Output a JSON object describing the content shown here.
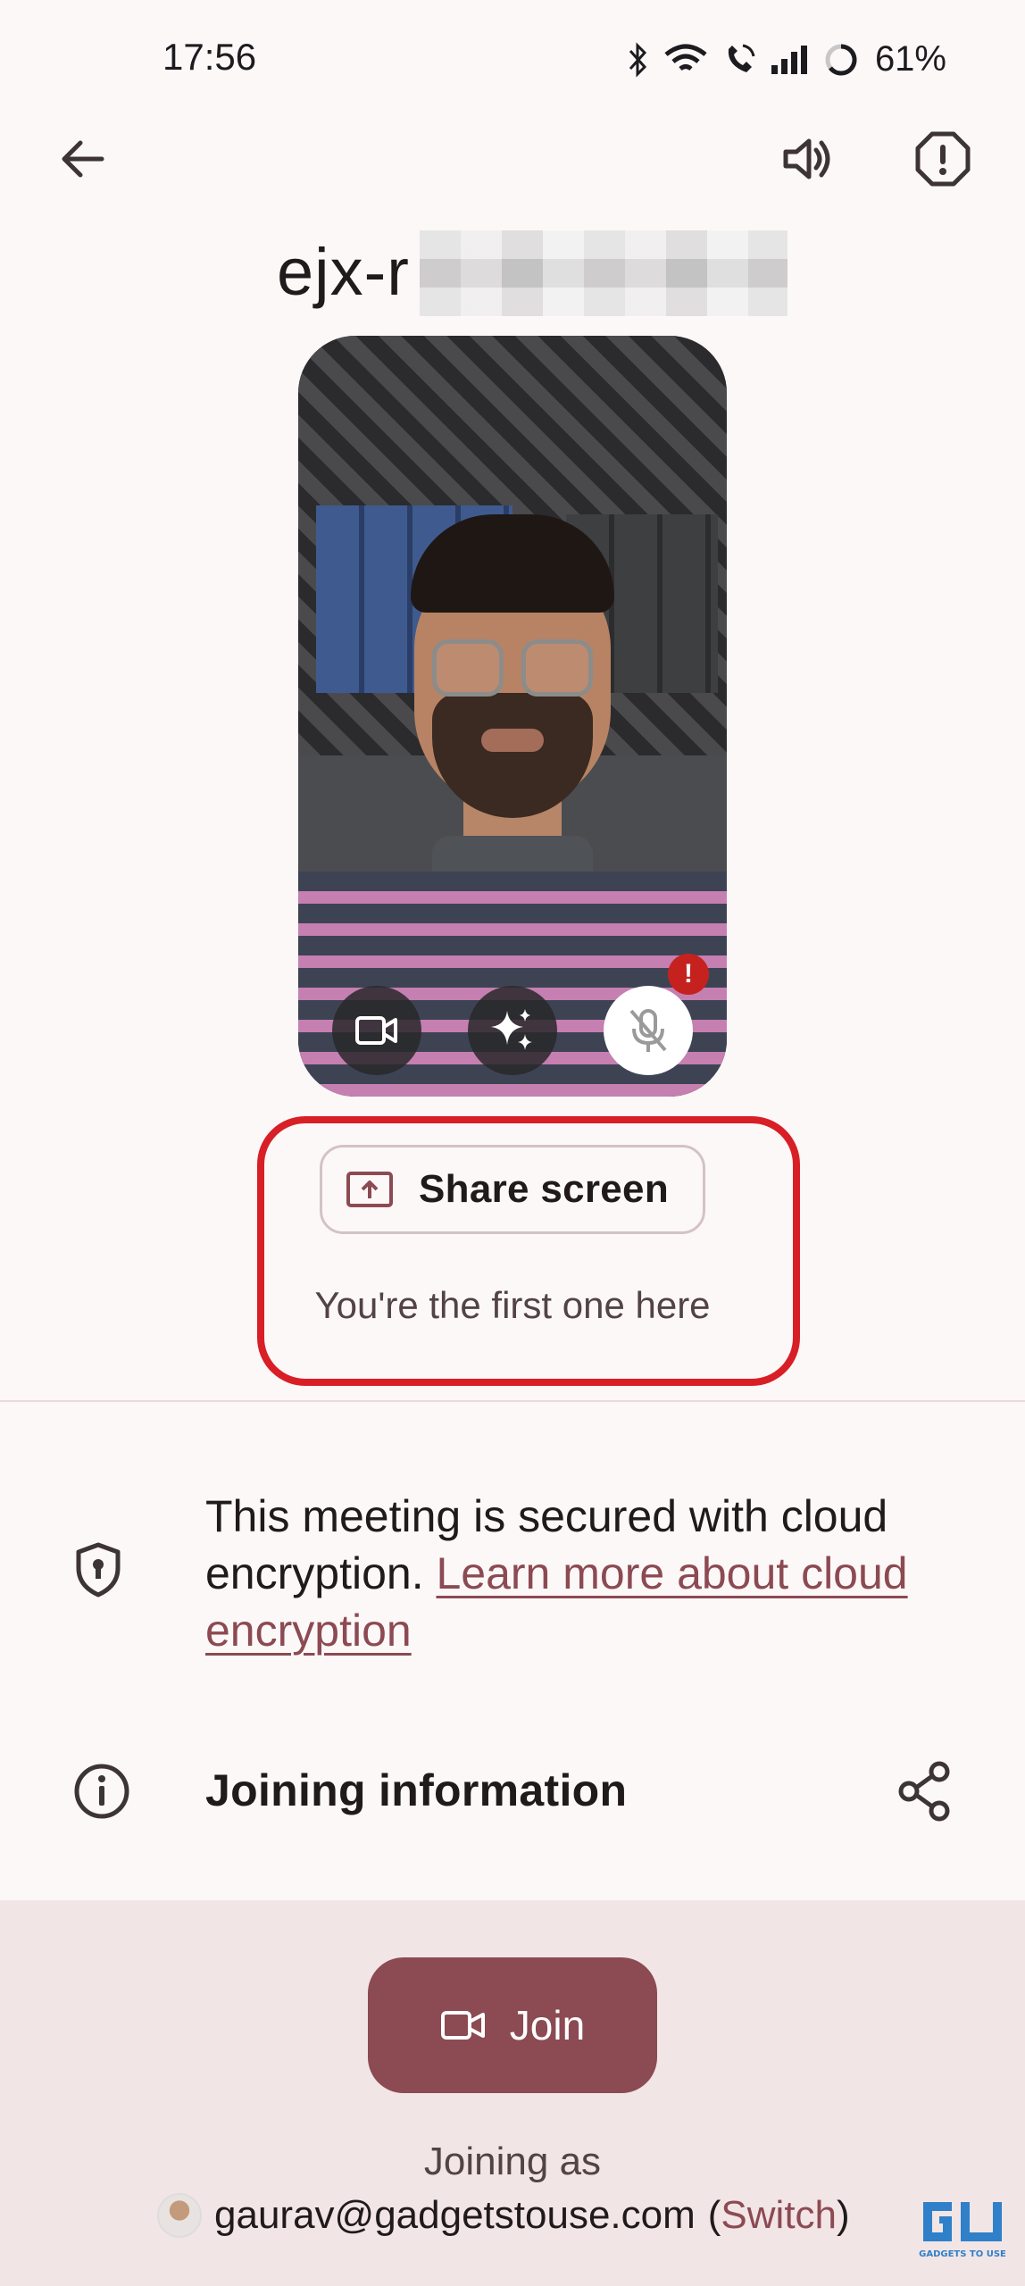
{
  "status_bar": {
    "time": "17:56",
    "battery": "61%"
  },
  "top_bar": {
    "back_icon": "arrow-back-icon",
    "audio_icon": "speaker-icon",
    "report_icon": "report-octagon-icon"
  },
  "meeting": {
    "code_visible": "ejx-r"
  },
  "preview_controls": {
    "camera_icon": "videocam-icon",
    "effects_icon": "sparkle-icon",
    "mic_icon": "mic-off-icon"
  },
  "share": {
    "label": "Share screen",
    "status": "You're the first one here"
  },
  "security": {
    "text": "This meeting is secured with cloud encryption. ",
    "link": "Learn more about cloud encryption"
  },
  "joining_info": {
    "label": "Joining information"
  },
  "join": {
    "label": "Join",
    "joining_as": "Joining as",
    "email": "gaurav@gadgetstouse.com",
    "switch_label": "Switch"
  },
  "watermark": {
    "text": "GADGETS TO USE"
  },
  "colors": {
    "accent": "#8c4a52",
    "highlight": "#d81f26",
    "background": "#fdf8f8",
    "sheet": "#f2e5e6"
  }
}
